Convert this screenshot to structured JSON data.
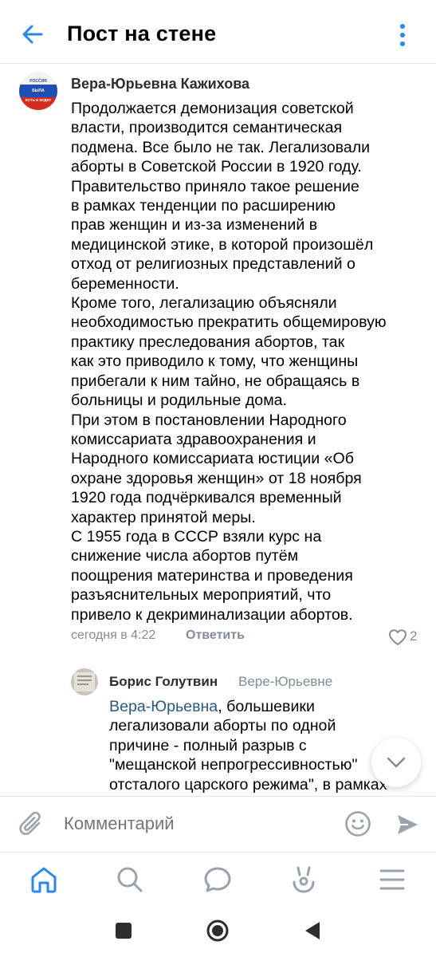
{
  "header": {
    "title": "Пост на стене",
    "back_icon": "arrow-left-icon",
    "menu_icon": "more-vertical-icon"
  },
  "post": {
    "author": "Вера-Юрьевна Кажихова",
    "avatar_text": [
      "РОССИЯ",
      "БЫЛА",
      "ЕСТЬ И БУДЕТ"
    ],
    "text": "Продолжается демонизация советской\nвласти, производится семантическая\nподмена. Все было не так. Легализовали\nаборты  в Советской России в 1920 году.\nПравительство приняло такое решение\nв рамках тенденции по расширению\nправ женщин и из-за изменений в\nмедицинской этике, в которой произошёл\nотход от религиозных представлений о\nбеременности.\nКроме того, легализацию объясняли\nнеобходимостью прекратить общемировую\nпрактику преследования абортов, так\nкак это приводило к тому, что женщины\nприбегали к ним тайно, не обращаясь в\nбольницы и родильные дома.\nПри этом в постановлении Народного\nкомиссариата здравоохранения и\nНародного комиссариата юстиции «Об\nохране здоровья женщин» от 18 ноября\n1920 года подчёркивался временный\nхарактер принятой меры.\nС 1955 года в СССР взяли курс на\nснижение числа абортов путём\nпоощрения материнства и проведения\nразъяснительных мероприятий, что\nпривело к декриминализации абортов.",
    "time": "сегодня в 4:22",
    "reply_label": "Ответить",
    "like_count": "2",
    "like_icon": "heart-icon"
  },
  "reply": {
    "author": "Борис Голутвин",
    "reply_to": "Вере-Юрьевне",
    "mention": "Вера-Юрьевна",
    "text_rest": ", большевики\nлегализовали аборты по одной\nпричине - полный разрыв с\n\"мещанской непрогрессивностью\"\nотсталого царского режима\", в рамках\n\"прогрессивной\""
  },
  "composer": {
    "placeholder": "Комментарий",
    "attach_icon": "paperclip-icon",
    "emoji_icon": "smile-icon",
    "send_icon": "send-icon"
  },
  "bottom_nav": [
    "home-icon",
    "search-icon",
    "messages-icon",
    "clips-icon",
    "menu-icon"
  ],
  "colors": {
    "accent": "#2688eb",
    "secondary_text": "#818c99",
    "link": "#2a5885",
    "divider": "#e7e8ec"
  }
}
